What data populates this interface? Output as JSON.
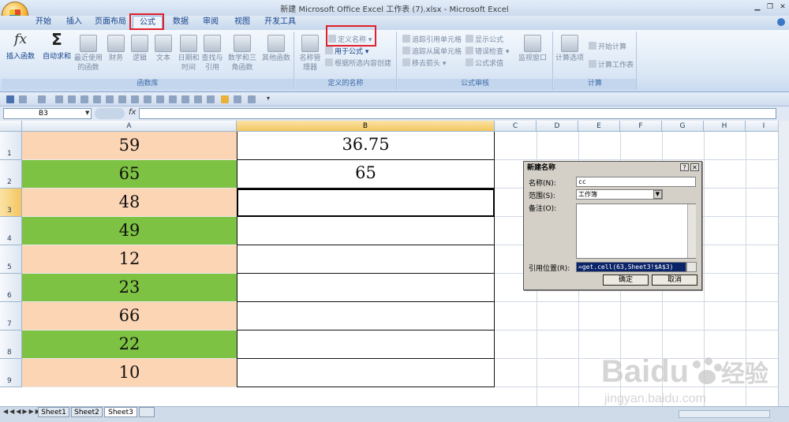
{
  "window": {
    "title": "新建 Microsoft Office Excel 工作表 (7).xlsx - Microsoft Excel"
  },
  "tabs": [
    "开始",
    "插入",
    "页面布局",
    "公式",
    "数据",
    "审阅",
    "视图",
    "开发工具"
  ],
  "active_tab": "公式",
  "ribbon": {
    "library": {
      "label": "函数库",
      "insert_function": "插入函数",
      "autosum": "自动求和",
      "recent": "最近使用的函数",
      "financial": "财务",
      "logical": "逻辑",
      "text": "文本",
      "datetime": "日期和时间",
      "lookup": "查找与引用",
      "math": "数学和三角函数",
      "other": "其他函数"
    },
    "names": {
      "label": "定义的名称",
      "manager": "名称管理器",
      "define": "定义名称",
      "use_in_formula": "用于公式",
      "create_from_selection": "根据所选内容创建"
    },
    "audit": {
      "label": "公式审核",
      "trace_precedents": "追踪引用单元格",
      "trace_dependents": "追踪从属单元格",
      "remove_arrows": "移去箭头",
      "show_formulas": "显示公式",
      "error_check": "错误检查",
      "evaluate": "公式求值",
      "watch": "监视窗口"
    },
    "calc": {
      "label": "计算",
      "options": "计算选项",
      "calc_now": "开始计算",
      "calc_sheet": "计算工作表"
    }
  },
  "formula_bar": {
    "name_box": "B3",
    "fx": "fx",
    "formula": ""
  },
  "columns": [
    "A",
    "B",
    "C",
    "D",
    "E",
    "F",
    "G",
    "H",
    "I"
  ],
  "rows": [
    {
      "num": "1",
      "a": "59",
      "b": "36.75",
      "a_color": "#fcd5b5"
    },
    {
      "num": "2",
      "a": "65",
      "b": "65",
      "a_color": "#7dc242"
    },
    {
      "num": "3",
      "a": "48",
      "b": "",
      "a_color": "#fcd5b5"
    },
    {
      "num": "4",
      "a": "49",
      "b": "",
      "a_color": "#7dc242"
    },
    {
      "num": "5",
      "a": "12",
      "b": "",
      "a_color": "#fcd5b5"
    },
    {
      "num": "6",
      "a": "23",
      "b": "",
      "a_color": "#7dc242"
    },
    {
      "num": "7",
      "a": "66",
      "b": "",
      "a_color": "#fcd5b5"
    },
    {
      "num": "8",
      "a": "22",
      "b": "",
      "a_color": "#7dc242"
    },
    {
      "num": "9",
      "a": "10",
      "b": "",
      "a_color": "#fcd5b5"
    }
  ],
  "dialog": {
    "title": "新建名称",
    "help": "?",
    "close": "✕",
    "name_label": "名称(N):",
    "name_value": "cc",
    "scope_label": "范围(S):",
    "scope_value": "工作簿",
    "comment_label": "备注(O):",
    "comment_value": "",
    "refers_label": "引用位置(R):",
    "refers_value": "=get.cell(63,Sheet3!$A$3)",
    "ok": "确定",
    "cancel": "取消"
  },
  "sheets": [
    "Sheet1",
    "Sheet2",
    "Sheet3"
  ],
  "active_sheet": "Sheet3",
  "watermark": {
    "brand": "Baidu",
    "cn": "经验",
    "url": "jingyan.baidu.com"
  }
}
